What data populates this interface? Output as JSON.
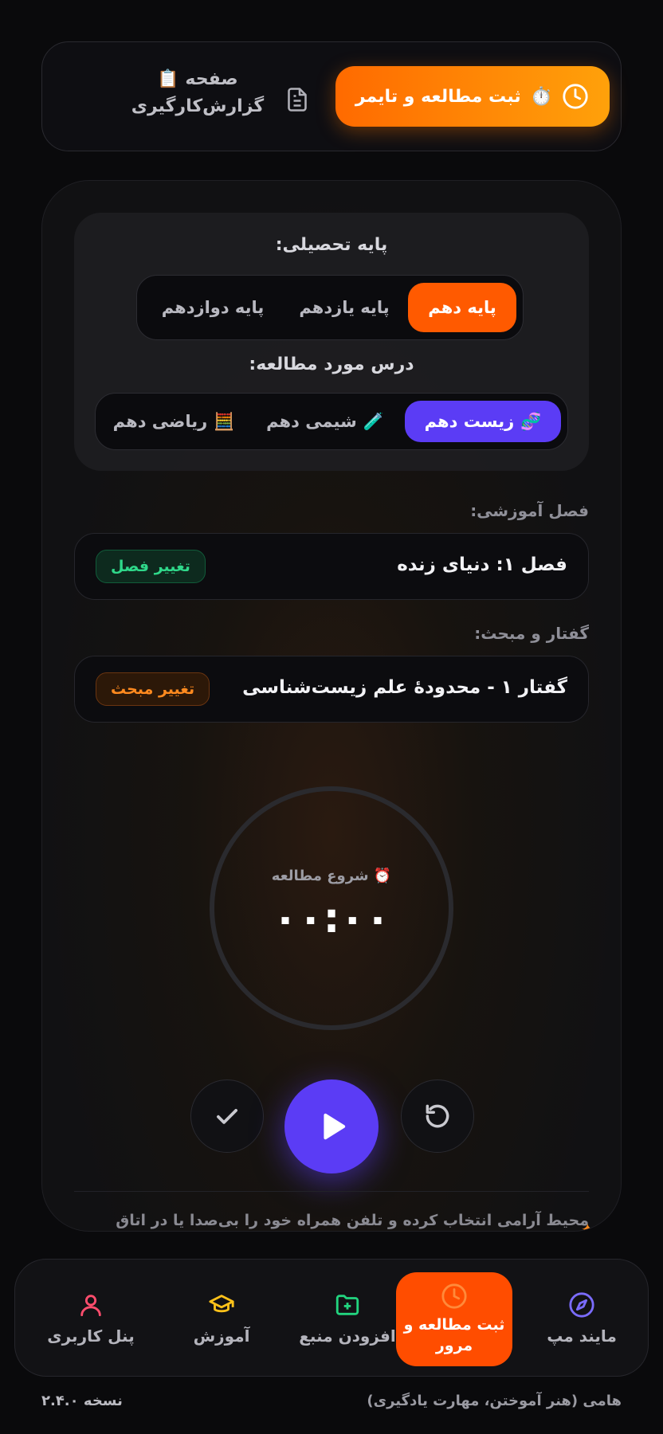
{
  "header": {
    "timer_button_label": "ثبت مطالعه و تایمر",
    "report_link_line1": "صفحه",
    "report_link_line2": "گزارش‌کارگیری"
  },
  "grade": {
    "title": "پایه تحصیلی:",
    "options": [
      "پایه دهم",
      "پایه یازدهم",
      "پایه دوازدهم"
    ],
    "selected": "پایه دهم"
  },
  "subject": {
    "title": "درس مورد مطالعه:",
    "options": [
      "زیست دهم",
      "شیمی دهم",
      "ریاضی دهم"
    ],
    "selected": "زیست دهم"
  },
  "chapter": {
    "label": "فصل آموزشی:",
    "value": "فصل ۱: دنیای زنده",
    "change_label": "تغییر فصل"
  },
  "topic": {
    "label": "گفتار و مبحث:",
    "value": "گفتار ۱ - محدودهٔ علم زیست‌شناسی",
    "change_label": "تغییر مبحث"
  },
  "timer": {
    "status_label": "شروع مطالعه",
    "time_display": "۰۰:۰۰"
  },
  "tip_text": "محیط آرامی انتخاب کرده و تلفن همراه خود را بی‌صدا یا در اتاق دیگری",
  "bottom_nav": {
    "items": [
      "پنل کاربری",
      "آموزش",
      "افزودن منبع",
      "ثبت مطالعه و مرور",
      "مایند مپ"
    ],
    "active": "ثبت مطالعه و مرور"
  },
  "footer": {
    "version": "نسخه ۲.۴.۰",
    "tagline": "هامی (هنر آموختن، مهارت یادگیری)"
  },
  "colors": {
    "accent_orange": "#ff5a00",
    "accent_purple": "#5b3cf5",
    "success_green": "#2fd88a"
  }
}
